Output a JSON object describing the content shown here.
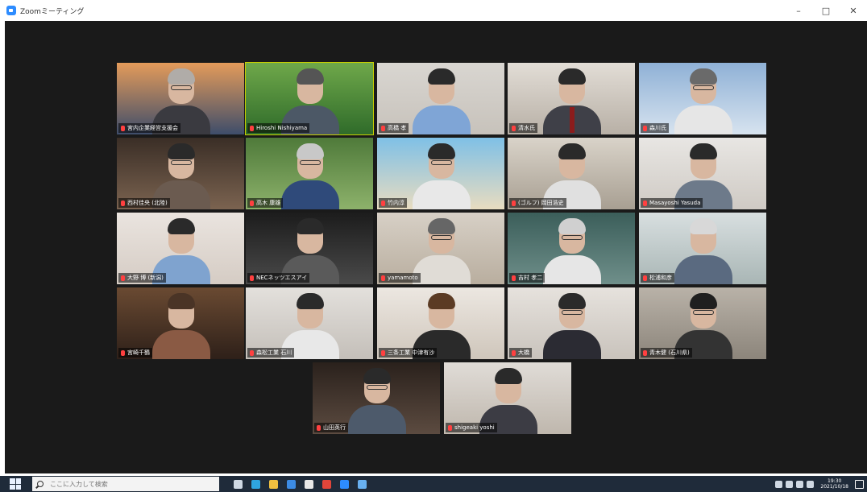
{
  "window": {
    "title": "Zoomミーティング",
    "minimize_glyph": "–",
    "maximize_glyph": "□",
    "close_glyph": "✕"
  },
  "participants": [
    {
      "name": "宮内企業経営支援会",
      "bg": [
        "#e49b5a",
        "#3e4d6a"
      ],
      "hair": "#b0aca8",
      "shirt": "#3a3a40",
      "glasses": true
    },
    {
      "name": "Hiroshi Nishiyama",
      "bg": [
        "#6fa84a",
        "#2f6b2a"
      ],
      "hair": "#555",
      "shirt": "#4c5866",
      "glasses": false,
      "active": true
    },
    {
      "name": "高橋 孝",
      "bg": [
        "#d9d6d1",
        "#c7c2bb"
      ],
      "hair": "#2a2a2a",
      "shirt": "#7fa5d6",
      "glasses": false
    },
    {
      "name": "清水氏",
      "bg": [
        "#e2ddd6",
        "#b8b0a6"
      ],
      "hair": "#2a2a2a",
      "shirt": "#3f4048",
      "glasses": false,
      "tie": true
    },
    {
      "name": "森川氏",
      "bg": [
        "#8fb1d6",
        "#d7e3ef"
      ],
      "hair": "#6a6a6a",
      "shirt": "#e6e6e6",
      "glasses": true
    },
    {
      "name": "西村佳央 (北陸)",
      "bg": [
        "#3a2e26",
        "#7b6350"
      ],
      "hair": "#2a2a2a",
      "shirt": "#6b5b50",
      "glasses": true
    },
    {
      "name": "高木 康雄",
      "bg": [
        "#4f7a3a",
        "#8db26b"
      ],
      "hair": "#c8c8c8",
      "shirt": "#2f4a7a",
      "glasses": true
    },
    {
      "name": "竹内淳",
      "bg": [
        "#7fc0e6",
        "#e8dcc0"
      ],
      "hair": "#2a2a2a",
      "shirt": "#e8e8e8",
      "glasses": true
    },
    {
      "name": "(ゴルフ) 岡田浩史",
      "bg": [
        "#d9d3c9",
        "#a89f92"
      ],
      "hair": "#2a2a2a",
      "shirt": "#e0e0e0",
      "glasses": false
    },
    {
      "name": "Masayoshi Yasuda",
      "bg": [
        "#e8e6e3",
        "#cfcac4"
      ],
      "hair": "#2a2a2a",
      "shirt": "#6d7a8a",
      "glasses": false
    },
    {
      "name": "大野 博 (新潟)",
      "bg": [
        "#eae4df",
        "#d5ccc4"
      ],
      "hair": "#2a2a2a",
      "shirt": "#7fa3cf",
      "glasses": false
    },
    {
      "name": "NECネッツエスアイ",
      "bg": [
        "#1c1c1c",
        "#4a4a4a"
      ],
      "hair": "#2a2a2a",
      "shirt": "#5a5a5a",
      "glasses": false
    },
    {
      "name": "yamamoto",
      "bg": [
        "#d7d0c6",
        "#b9ae9f"
      ],
      "hair": "#666",
      "shirt": "#e0dcd6",
      "glasses": true
    },
    {
      "name": "吉村 孝二",
      "bg": [
        "#3b5e5a",
        "#6f8f8a"
      ],
      "hair": "#d0d0d0",
      "shirt": "#e6e6e6",
      "glasses": true
    },
    {
      "name": "松浦和彦",
      "bg": [
        "#d8dfe0",
        "#a9b6b5"
      ],
      "hair": "#d8d8d8",
      "shirt": "#5a6a80",
      "glasses": false
    },
    {
      "name": "宮崎千鶴",
      "bg": [
        "#6a4a32",
        "#2e2019"
      ],
      "hair": "#4a3426",
      "shirt": "#8a5a44",
      "glasses": false
    },
    {
      "name": "森松工業 石川",
      "bg": [
        "#e3e0dc",
        "#c4bfb9"
      ],
      "hair": "#2a2a2a",
      "shirt": "#e8e8e8",
      "glasses": false
    },
    {
      "name": "三条工業 中津有沙",
      "bg": [
        "#ece7e1",
        "#cfc6bb"
      ],
      "hair": "#5b3b24",
      "shirt": "#2a2a2a",
      "glasses": false
    },
    {
      "name": "大橋",
      "bg": [
        "#e6e2dd",
        "#c9c3bc"
      ],
      "hair": "#2a2a2a",
      "shirt": "#2b2b33",
      "glasses": true
    },
    {
      "name": "青木健 (石川県)",
      "bg": [
        "#b9b2a8",
        "#8c857b"
      ],
      "hair": "#1f1f1f",
      "shirt": "#333",
      "glasses": true
    },
    {
      "name": "山田英行",
      "bg": [
        "#2a211c",
        "#5c4b40"
      ],
      "hair": "#2a2a2a",
      "shirt": "#4d5a6b",
      "glasses": true
    },
    {
      "name": "shigeaki yoshi",
      "bg": [
        "#e0dcd7",
        "#bfb7ad"
      ],
      "hair": "#2a2a2a",
      "shirt": "#3c3c44",
      "glasses": false
    }
  ],
  "taskbar": {
    "search_placeholder": "ここに入力して検索",
    "clock_time": "19:30",
    "clock_date": "2021/10/18",
    "apps": [
      {
        "name": "task-view-icon",
        "color": "#cfd8e3"
      },
      {
        "name": "edge-icon",
        "color": "#2fa5e0"
      },
      {
        "name": "explorer-icon",
        "color": "#f0c040"
      },
      {
        "name": "mail-icon",
        "color": "#3c8ce6"
      },
      {
        "name": "store-icon",
        "color": "#e8e8e8"
      },
      {
        "name": "chrome-icon",
        "color": "#e0453a"
      },
      {
        "name": "zoom-icon",
        "color": "#2d8cff"
      },
      {
        "name": "app-icon",
        "color": "#68b0f0"
      }
    ]
  }
}
